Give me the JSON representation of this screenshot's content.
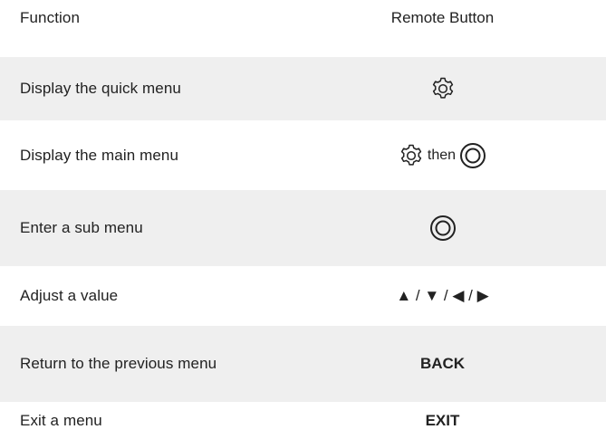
{
  "header": {
    "function_label": "Function",
    "button_label": "Remote Button"
  },
  "rows": [
    {
      "function": "Display the quick menu",
      "icons": [
        "gear-icon"
      ]
    },
    {
      "function": "Display the main menu",
      "icons": [
        "gear-icon",
        "ok-circle-icon"
      ],
      "joiner": "then"
    },
    {
      "function": "Enter a sub menu",
      "icons": [
        "ok-circle-icon"
      ]
    },
    {
      "function": "Adjust a value",
      "button_text": "▲ / ▼ / ◀ / ▶"
    },
    {
      "function": "Return to the previous menu",
      "button_text": "BACK"
    },
    {
      "function": "Exit a menu",
      "button_text": "EXIT"
    }
  ],
  "colors": {
    "shade": "#efefef",
    "text": "#222222"
  }
}
